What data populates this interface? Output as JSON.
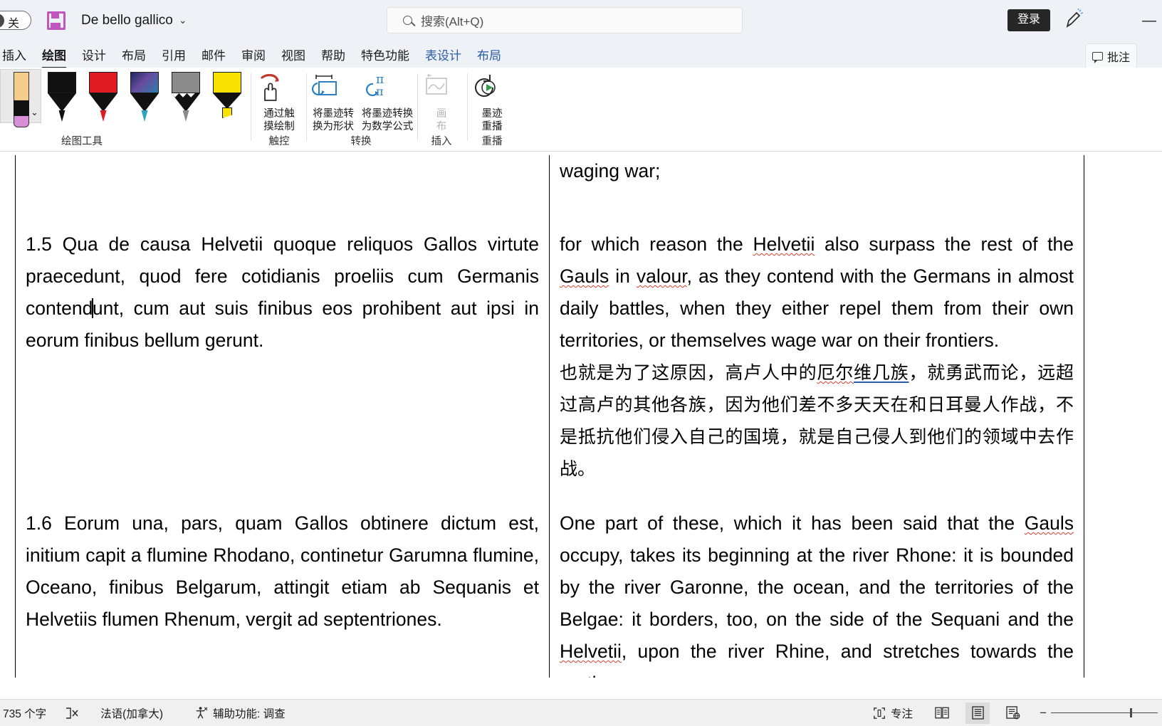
{
  "titlebar": {
    "autosave_label": "关",
    "save_icon": "save-icon",
    "document_title": "De bello gallico",
    "title_chevron": "⌄",
    "search_placeholder": "搜索(Alt+Q)",
    "search_icon": "search-icon",
    "signin_label": "登录",
    "pen_icon": "pen-annotate-icon",
    "minimize_label": "—"
  },
  "tabs": [
    {
      "label": "插入",
      "state": "normal"
    },
    {
      "label": "绘图",
      "state": "active"
    },
    {
      "label": "设计",
      "state": "normal"
    },
    {
      "label": "布局",
      "state": "normal"
    },
    {
      "label": "引用",
      "state": "normal"
    },
    {
      "label": "邮件",
      "state": "normal"
    },
    {
      "label": "审阅",
      "state": "normal"
    },
    {
      "label": "视图",
      "state": "normal"
    },
    {
      "label": "帮助",
      "state": "normal"
    },
    {
      "label": "特色功能",
      "state": "normal"
    },
    {
      "label": "表设计",
      "state": "contextual"
    },
    {
      "label": "布局",
      "state": "contextual"
    }
  ],
  "comments_button": "批注",
  "ribbon": {
    "groups": {
      "drawing_tools": {
        "label": "绘图工具",
        "pens": [
          {
            "name": "eraser-pen-selected",
            "colors": {
              "top": "#f5cd8b",
              "mid": "#111111",
              "bot": "#d78fd7"
            }
          },
          {
            "name": "black-pen",
            "color": "#111111"
          },
          {
            "name": "red-pen",
            "color": "#e01b24"
          },
          {
            "name": "galaxy-pen",
            "color": "#2b3f7a"
          },
          {
            "name": "gray-pencil",
            "color": "#8b8b8b"
          },
          {
            "name": "yellow-highlighter",
            "color": "#f7e100"
          }
        ]
      },
      "touch": {
        "label": "触控",
        "button": {
          "line1": "通过触",
          "line2": "摸绘制",
          "icon": "draw-with-touch-icon",
          "enabled": true
        }
      },
      "convert": {
        "label": "转换",
        "buttons": [
          {
            "line1": "将墨迹转",
            "line2": "换为形状",
            "icon": "ink-to-shape-icon",
            "enabled": true
          },
          {
            "line1": "将墨迹转换",
            "line2": "为数学公式",
            "icon": "ink-to-math-icon",
            "enabled": true
          }
        ]
      },
      "insert": {
        "label": "插入",
        "button": {
          "line1": "画",
          "line2": "布",
          "icon": "drawing-canvas-icon",
          "enabled": false
        }
      },
      "replay": {
        "label": "重播",
        "button": {
          "line1": "墨迹",
          "line2": "重播",
          "icon": "ink-replay-icon",
          "enabled": true
        }
      }
    }
  },
  "document": {
    "rows": [
      {
        "left": "",
        "right_lines": [
          "waging war;"
        ],
        "type": "continuation"
      },
      {
        "left": "1.5 Qua de causa Helvetii quoque reliquos Gallos virtute praecedunt, quod fere cotidianis proeliis cum Germanis contendunt, cum aut suis finibus eos prohibent aut ipsi in eorum finibus bellum gerunt.",
        "left_caret_after": "contend",
        "right_en": "for which reason the Helvetii also surpass the rest of the Gauls in valour, as they contend with the Germans in almost daily battles, when they either repel them from their own territories, or themselves wage war on their frontiers.",
        "right_zh": "也就是为了这原因，高卢人中的厄尔维几族，就勇武而论，远超过高卢的其他各族，因为他们差不多天天在和日耳曼人作战，不是抵抗他们侵入自己的国境，就是自己侵人到他们的领域中去作战。",
        "spellcheck_words": [
          "Helvetii",
          "Gauls",
          "valour",
          "厄尔"
        ],
        "link_words": [
          "维几族"
        ]
      },
      {
        "left": "1.6 Eorum una, pars, quam Gallos obtinere dictum est, initium capit a flumine Rhodano, continetur Garumna flumine, Oceano, finibus Belgarum, attingit etiam ab Sequanis et Helvetiis flumen Rhenum, vergit ad septentriones.",
        "right_en": "One part of these, which it has been said that the Gauls occupy, takes its beginning at the river Rhone: it is bounded by the river Garonne, the ocean, and the territories of the Belgae: it borders, too, on the side of the Sequani and the Helvetii, upon the river Rhine, and stretches towards the north.",
        "spellcheck_words": [
          "Gauls",
          "Helvetii"
        ]
      }
    ]
  },
  "statusbar": {
    "word_count": "735 个字",
    "proofing_icon": "proofing-errors-icon",
    "language": "法语(加拿大)",
    "accessibility_icon": "accessibility-icon",
    "accessibility_label": "辅助功能: 调查",
    "focus_icon": "focus-mode-icon",
    "focus_label": "专注",
    "view_read_icon": "read-mode-icon",
    "view_print_icon": "print-layout-icon",
    "view_web_icon": "web-layout-icon",
    "zoom_minus": "−"
  }
}
